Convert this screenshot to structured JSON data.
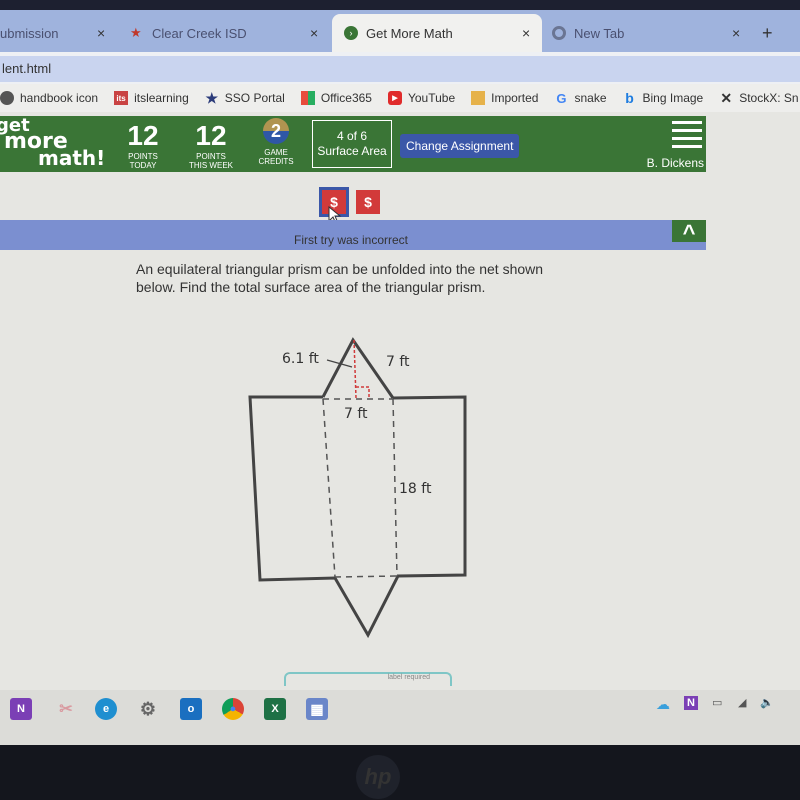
{
  "browser": {
    "tabs": [
      {
        "label": "ubmission",
        "icon": "page-icon"
      },
      {
        "label": "Clear Creek ISD",
        "icon": "star-icon"
      },
      {
        "label": "Get More Math",
        "icon": "gmm-icon",
        "active": true
      },
      {
        "label": "New Tab",
        "icon": "chrome-icon"
      }
    ],
    "new_tab_label": "+",
    "close_label": "×",
    "address": "lent.html",
    "bookmarks": [
      {
        "label": "handbook icon",
        "icon": "globe-icon"
      },
      {
        "label": "itslearning",
        "icon": "its-icon",
        "icon_text": "its"
      },
      {
        "label": "SSO Portal",
        "icon": "star-icon"
      },
      {
        "label": "Office365",
        "icon": "office-icon"
      },
      {
        "label": "YouTube",
        "icon": "youtube-icon"
      },
      {
        "label": "Imported",
        "icon": "folder-icon"
      },
      {
        "label": "snake",
        "icon": "google-icon",
        "icon_text": "G"
      },
      {
        "label": "Bing Image",
        "icon": "bing-icon",
        "icon_text": "b"
      },
      {
        "label": "StockX: Sn",
        "icon": "stockx-icon",
        "icon_text": "✕"
      }
    ]
  },
  "app": {
    "logo": [
      "get",
      "more",
      "math!"
    ],
    "stats": [
      {
        "value": "12",
        "label1": "POINTS",
        "label2": "TODAY"
      },
      {
        "value": "12",
        "label1": "POINTS",
        "label2": "THIS WEEK"
      },
      {
        "value": "2",
        "label1": "GAME",
        "label2": "CREDITS"
      }
    ],
    "assignment": {
      "progress": "4 of 6",
      "topic": "Surface Area"
    },
    "change_assignment_label": "Change Assignment",
    "user_name": "B. Dickens",
    "coin_symbol": "$",
    "feedback": "First try was incorrect",
    "collapse_symbol": "^",
    "question": "An equilateral triangular prism can be unfolded into the net shown below. Find the total surface area of the triangular prism.",
    "figure": {
      "slant_height_label": "6.1 ft",
      "side_label": "7 ft",
      "base_label": "7 ft",
      "length_label": "18 ft"
    },
    "hidden_tab_label": "label required"
  },
  "taskbar": {
    "apps": [
      {
        "name": "onenote",
        "text": "N",
        "color": "#7b3fb5"
      },
      {
        "name": "snipping-tool",
        "text": "✂",
        "color": "#d99aa0"
      },
      {
        "name": "edge",
        "text": "e",
        "color": "#1f8fd0"
      },
      {
        "name": "settings",
        "text": "⚙",
        "color": "#666666"
      },
      {
        "name": "outlook",
        "text": "o",
        "color": "#1a6fc0"
      },
      {
        "name": "chrome",
        "text": "●",
        "color": "#db4437"
      },
      {
        "name": "excel",
        "text": "X",
        "color": "#1e7145"
      },
      {
        "name": "calculator",
        "text": "▦",
        "color": "#6a86c9"
      }
    ],
    "tray": [
      "☁",
      "N",
      "▭",
      "◢",
      "🔈"
    ]
  },
  "device_logo": "hp"
}
